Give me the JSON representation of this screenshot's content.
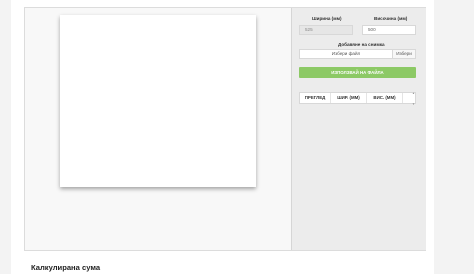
{
  "form": {
    "width_label": "Ширина (мм)",
    "width_value": "525",
    "height_label": "Височина (мм)",
    "height_value": "500",
    "add_image_label": "Добавяне на снимка",
    "file_choose_label": "Избери файл",
    "file_browse_label": "Избери",
    "upload_button_label": "ИЗПОЛЗВАЙ НА ФАЙЛА"
  },
  "table": {
    "columns": [
      "ПРЕГЛЕД",
      "ШИР. (ММ)",
      "ВИС. (ММ)",
      ""
    ]
  },
  "section": {
    "title": "Калкулирана сума"
  }
}
